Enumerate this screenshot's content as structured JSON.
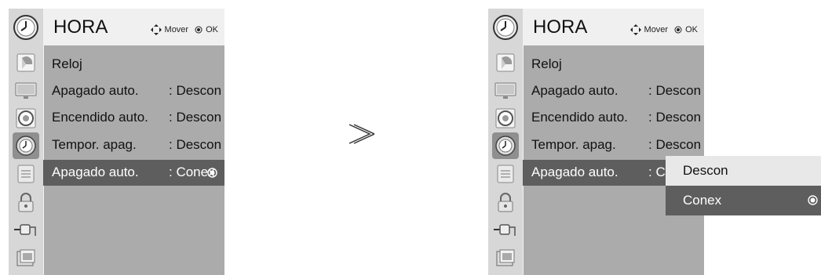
{
  "menu": {
    "title": "HORA",
    "hint_move": "Mover",
    "hint_ok": "OK",
    "items": [
      {
        "label": "Reloj",
        "value": ""
      },
      {
        "label": "Apagado auto.",
        "value": ": Descon"
      },
      {
        "label": "Encendido auto.",
        "value": ": Descon"
      },
      {
        "label": "Tempor. apag.",
        "value": ": Descon"
      },
      {
        "label": "Apagado auto.",
        "value": ": Conex"
      }
    ],
    "sidebar_icons": [
      "picture-icon",
      "screen-icon",
      "audio-icon",
      "clock-icon",
      "option-icon",
      "lock-icon",
      "input-icon",
      "usb-photo-icon"
    ],
    "selected_icon": "clock-icon"
  },
  "menu_right": {
    "partial_value": ": C"
  },
  "arrow": "≫",
  "popup": {
    "options": [
      "Descon",
      "Conex"
    ],
    "selected": "Conex"
  }
}
